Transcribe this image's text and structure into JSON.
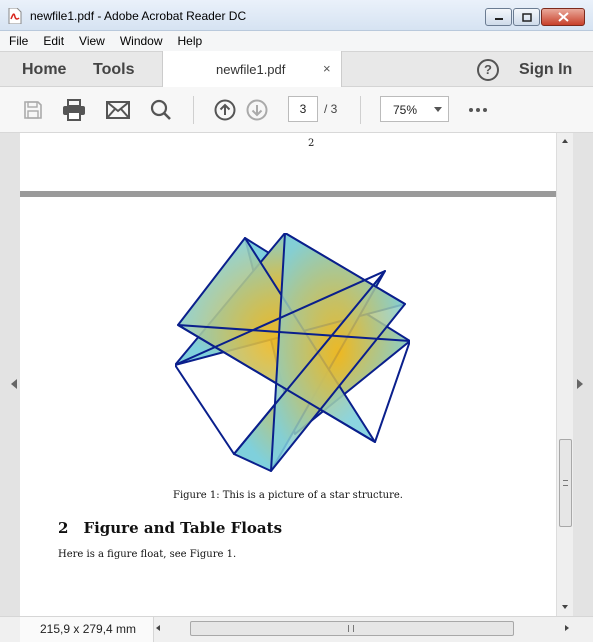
{
  "window": {
    "title": "newfile1.pdf - Adobe Acrobat Reader DC",
    "controls": [
      "minimize",
      "maximize",
      "close"
    ]
  },
  "menu": {
    "items": [
      {
        "label": "File"
      },
      {
        "label": "Edit"
      },
      {
        "label": "View"
      },
      {
        "label": "Window"
      },
      {
        "label": "Help"
      }
    ]
  },
  "tabs": {
    "home": "Home",
    "tools": "Tools",
    "document": "newfile1.pdf",
    "close_glyph": "×",
    "help_glyph": "?",
    "signin": "Sign In"
  },
  "toolbar": {
    "icons": [
      "save-icon",
      "print-icon",
      "email-icon",
      "search-icon",
      "page-up-icon",
      "page-down-icon",
      "more-icon"
    ],
    "current_page": "3",
    "total_pages": "/ 3",
    "zoom": "75%"
  },
  "document": {
    "prev_page_number": "2",
    "figure_caption": "Figure 1: This is a picture of a star structure.",
    "section_number": "2",
    "section_title": "Figure and Table Floats",
    "body_text": "Here is a figure float, see Figure 1.",
    "star": {
      "stroke_color": "#0a1f8c",
      "center_color": "#f2b71a",
      "edge_color": "#7fd0dc"
    }
  },
  "status": {
    "page_size": "215,9 x 279,4 mm"
  }
}
